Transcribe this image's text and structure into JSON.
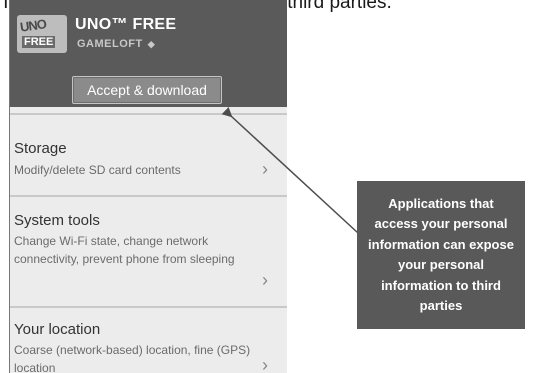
{
  "caption": "This information may be visible to third parties.",
  "app": {
    "logo_text_top": "UNO",
    "logo_text_bottom": "FREE",
    "title": "UNO™ FREE",
    "publisher": "GAMELOFT",
    "publisher_glyph": "◆",
    "accept_label": "Accept & download"
  },
  "permissions": [
    {
      "title": "Storage",
      "desc": "Modify/delete SD card contents"
    },
    {
      "title": "System tools",
      "desc": "Change Wi-Fi state, change network connectivity, prevent phone from sleeping"
    },
    {
      "title": "Your location",
      "desc": "Coarse (network-based) location, fine (GPS) location"
    }
  ],
  "callout": {
    "text": "Applications that access your personal information can expose your personal information to third parties"
  },
  "icons": {
    "chevron": "chevron-right-icon",
    "diamond": "diamond-icon"
  },
  "colors": {
    "appbar": "#5a5a5a",
    "callout": "#595959",
    "button": "#8b8b8b"
  }
}
